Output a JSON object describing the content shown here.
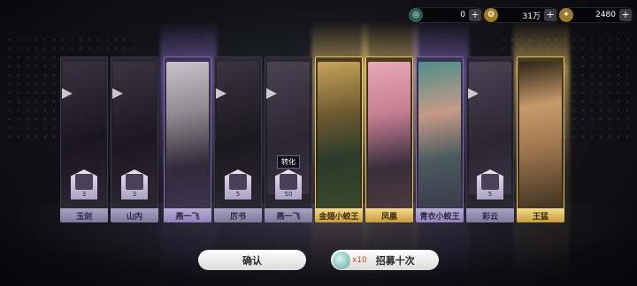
{
  "currency": [
    {
      "icon": "swirl-token-icon",
      "value": "0",
      "color": "#4fb3a8"
    },
    {
      "icon": "gold-coin-icon",
      "value": "31万",
      "color": "#e0b34a"
    },
    {
      "icon": "jade-icon",
      "value": "2480",
      "color": "#e8c56a"
    }
  ],
  "cards": [
    {
      "rarity": "common",
      "name": "玉剑",
      "shard": "3"
    },
    {
      "rarity": "common",
      "name": "山内",
      "shard": "3"
    },
    {
      "rarity": "purple",
      "name": "燕一飞",
      "big": true
    },
    {
      "rarity": "common",
      "name": "厉书",
      "shard": "5"
    },
    {
      "rarity": "common",
      "name": "燕一飞",
      "shard": "50",
      "convert": "转化"
    },
    {
      "rarity": "gold",
      "name": "金翅小蛟王",
      "big": true
    },
    {
      "rarity": "gold",
      "name": "凤凰",
      "big": true
    },
    {
      "rarity": "purple",
      "name": "青衣小蛟王",
      "big": true
    },
    {
      "rarity": "common",
      "name": "彩云",
      "shard": "5"
    },
    {
      "rarity": "gold",
      "name": "王猛",
      "big": true
    }
  ],
  "buttons": {
    "confirm": "确认",
    "recruit_count": "x10",
    "recruit": "招募十次"
  }
}
